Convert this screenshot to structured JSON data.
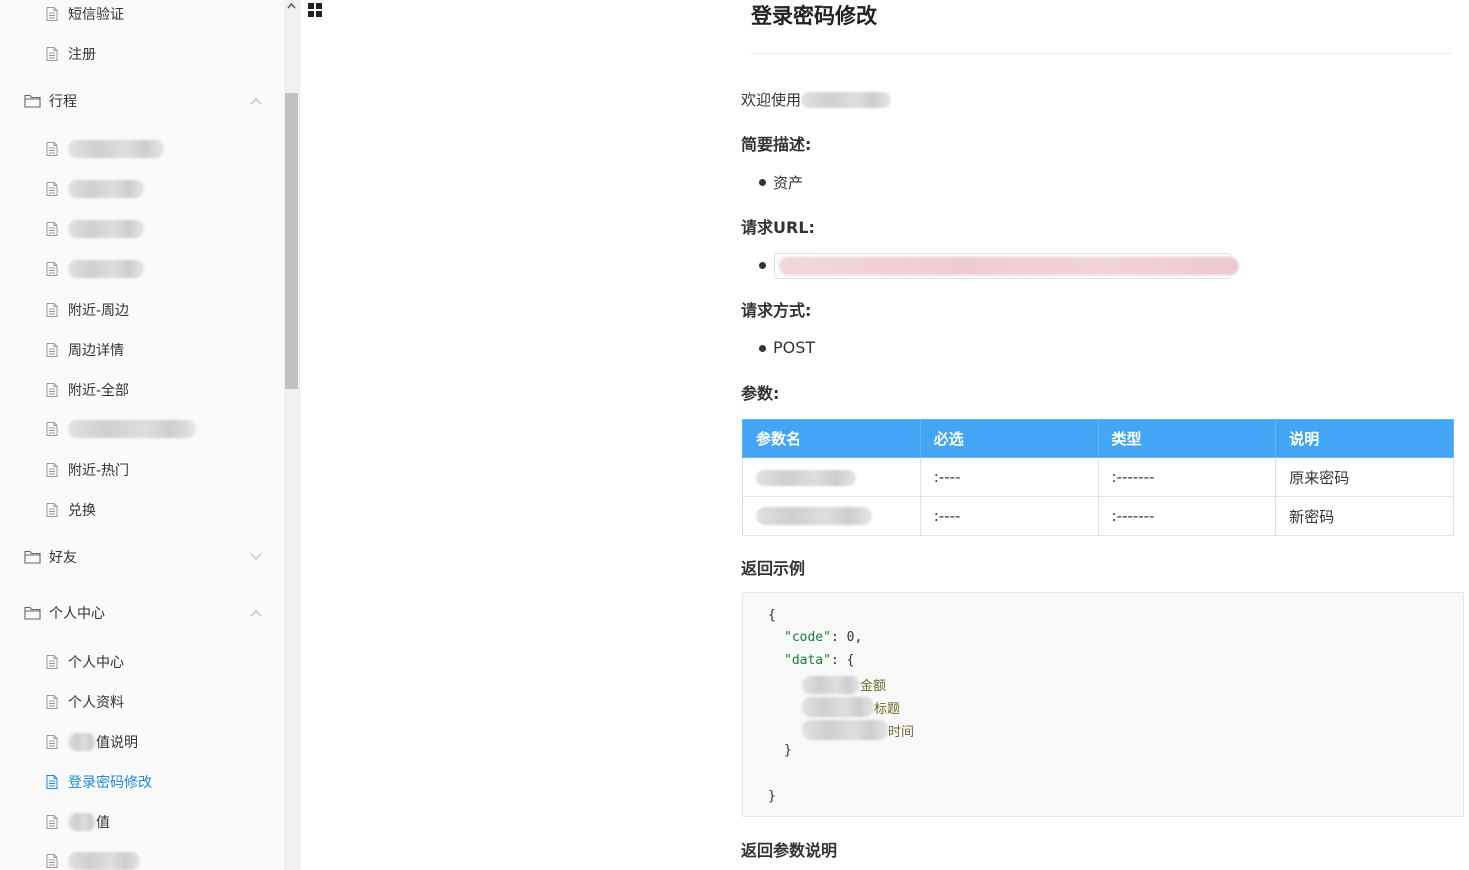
{
  "sidebar": {
    "items_top": [
      {
        "label": "短信验证"
      },
      {
        "label": "注册"
      }
    ],
    "groups": [
      {
        "label": "行程",
        "expanded": true
      },
      {
        "label": "好友",
        "expanded": false
      },
      {
        "label": "个人中心",
        "expanded": true
      }
    ],
    "trip_items": [
      {
        "label": ""
      },
      {
        "label": ""
      },
      {
        "label": ""
      },
      {
        "label": ""
      },
      {
        "label": "附近-周边"
      },
      {
        "label": "周边详情"
      },
      {
        "label": "附近-全部"
      },
      {
        "label": ""
      },
      {
        "label": "附近-热门"
      },
      {
        "label": "兑换"
      }
    ],
    "personal_items": [
      {
        "label": "个人中心"
      },
      {
        "label": "个人资料"
      },
      {
        "label": "值说明"
      },
      {
        "label": "登录密码修改",
        "active": true
      },
      {
        "label": "值"
      },
      {
        "label": ""
      }
    ]
  },
  "doc": {
    "title": "登录密码修改",
    "welcome": "欢迎使用",
    "summary_heading": "简要描述:",
    "summary_item": "资产",
    "url_heading": "请求URL:",
    "method_heading": "请求方式:",
    "method": "POST",
    "params_heading": "参数:",
    "params_table": {
      "headers": [
        "参数名",
        "必选",
        "类型",
        "说明"
      ],
      "rows": [
        {
          "name": "",
          "required": ":----",
          "type": ":-------",
          "desc": "原来密码"
        },
        {
          "name": "",
          "required": ":----",
          "type": ":-------",
          "desc": "新密码"
        }
      ]
    },
    "return_example_heading": "返回示例",
    "code": {
      "open": "{",
      "code_key": "\"code\"",
      "code_val": "0",
      "data_key": "\"data\"",
      "data_open": "{",
      "comment1": "金额",
      "comment2": "标题",
      "comment3": "时间",
      "data_close": "}",
      "close": "}"
    },
    "return_params_heading": "返回参数说明"
  },
  "colors": {
    "accent": "#1e88e5",
    "table_header": "#42a5f5"
  }
}
